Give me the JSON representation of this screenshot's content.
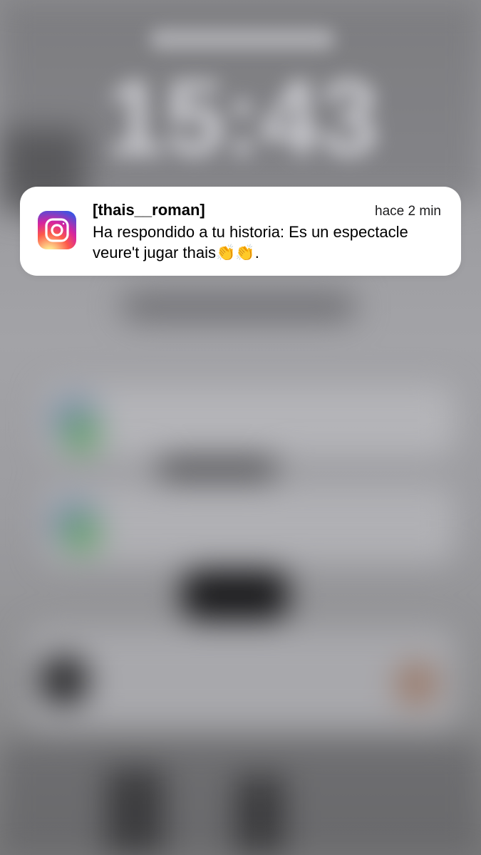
{
  "lockscreen": {
    "clock": "15:43"
  },
  "notification": {
    "app_icon": "instagram-icon",
    "sender": "[thais__roman]",
    "time": "hace 2 min",
    "message": "Ha respondido a tu historia: Es un espectacle veure't jugar  thais👏👏."
  },
  "colors": {
    "card_background": "#ffffff",
    "background": "#9c9ca0"
  }
}
